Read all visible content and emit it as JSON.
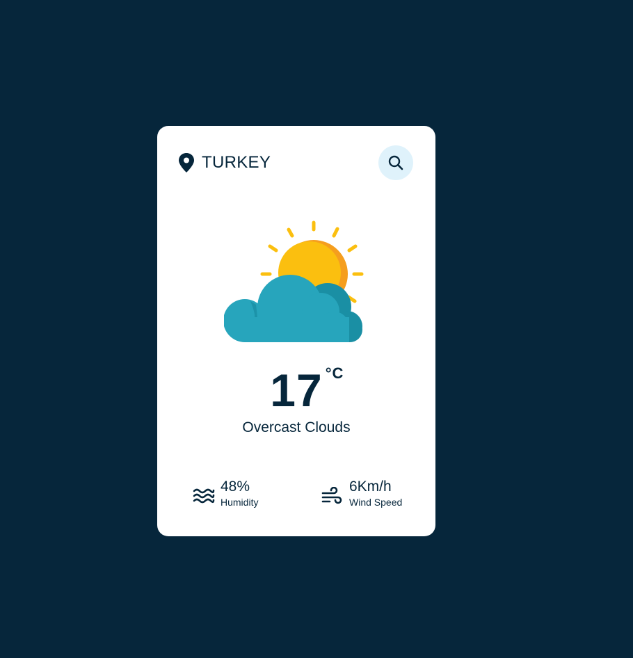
{
  "location": {
    "city": "TURKEY",
    "pin_icon": "location-pin-icon"
  },
  "search": {
    "icon": "search-icon",
    "button_color": "#dff2fb"
  },
  "weather": {
    "icon": "partly-cloudy-icon",
    "temperature": "17",
    "unit": "°C",
    "description": "Overcast Clouds"
  },
  "details": {
    "humidity": {
      "value": "48%",
      "label": "Humidity",
      "icon": "waves-icon"
    },
    "wind": {
      "value": "6Km/h",
      "label": "Wind Speed",
      "icon": "wind-icon"
    }
  },
  "colors": {
    "background": "#06263b",
    "card": "#ffffff",
    "text": "#06263b",
    "sun": "#fbbf0f",
    "sun_shade": "#f59e1e",
    "cloud": "#27a5bc",
    "cloud_shade": "#1a8fa4"
  }
}
